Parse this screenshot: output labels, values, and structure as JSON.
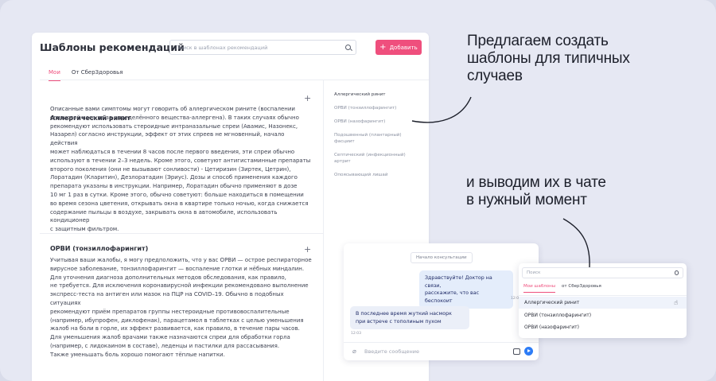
{
  "window": {
    "title": "Шаблоны рекомендаций",
    "search_placeholder": "Поиск в шаблонах рекомендаций",
    "add_label": "Добавить",
    "tabs": [
      "Мои",
      "От СберЗдоровья"
    ]
  },
  "templates": [
    {
      "title": "Аллергический ринит",
      "text": "Описанные вами симптомы могут говорить об аллергическом рините (воспалении\nслизистой носа из-за определённого вещества-аллергена). В таких случаях обычно\nрекомендуют использовать стероидные интраназальные спреи (Авамис, Назонекс,\nНазарел) согласно инструкции, эффект от этих спреев не мгновенный, начало действия\nможет наблюдаться в течении 8 часов после первого введения, эти спреи обычно\nиспользуют в течении 2–3 недель. Кроме этого, советуют антигистаминные препараты\nвторого поколения (они не вызывают сонливости) - Цетиризин (Зиртек, Цетрин),\nЛоратадин (Кларитин), Дезлоратадин (Эриус). Дозы и способ применения каждого\nпрепарата указаны в инструкции. Например, Лоратадин обычно применяют в дозе\n10 мг 1 раз в сутки. Кроме этого, обычно советуют: больше находиться в помещении\nво время сезона цветения, открывать окна в квартире только ночью, когда снижается\nсодержание пыльцы в воздухе, закрывать окна в автомобиле, использовать кондиционер\nс защитным фильтром."
    },
    {
      "title": "ОРВИ (тонзиллофарингит)",
      "text": "Учитывая ваши жалобы, я могу предположить, что у вас ОРВИ — острое респираторное\nвирусное заболевание, тонзиллофарингит — воспаление глотки и нёбных миндалин.\nДля уточнения диагноза дополнительных методов обследования, как правило,\nне требуется. Для исключения коронавирусной инфекции рекомендовано выполнение\nэкспресс-теста на антиген или мазок на ПЦР на COVID–19. Обычно в подобных ситуациях\nрекомендуют приём препаратов группы нестероидные противовоспалительные\n(например, ибупрофен, диклофенак), парацетамол в таблетках с целью уменьшения\nжалоб на боли в горле, их эффект развивается, как правило, в течение пары часов.\nДля уменьшения жалоб врачами также назначаются спреи для обработки горла\n(например, с лидокаином в составе), леденцы и пастилки для рассасывания.\nТакже уменьшать боль хорошо помогают тёплые напитки."
    }
  ],
  "nav": [
    "Аллергический ринит",
    "ОРВИ (тонзиллофарингит)",
    "ОРВИ (назофарингит)",
    "Подошвенный (плантарный)\nфасциит",
    "Септический (инфекционный)\nартрит",
    "Опоясывающий лишай"
  ],
  "headline1": "Предлагаем создать\nшаблоны для типичных\nслучаев",
  "headline2": "и выводим их в чате\nв нужный момент",
  "chat": {
    "start_label": "Начало консультации",
    "doctor_msg": "Здравствуйте! Доктор на связи,\nрасскажите, что вас беспокоит",
    "doctor_time": "12:01",
    "patient_msg": "В последнее время жуткий насморк\nпри встрече с тополиным пухом",
    "patient_time": "12:03",
    "input_placeholder": "Введите сообщение"
  },
  "dropdown": {
    "search_placeholder": "Поиск",
    "tabs": [
      "Мои шаблоны",
      "от СберЗдоровья"
    ],
    "items": [
      "Аллергический ринит",
      "ОРВИ (тонзиллофарингит)",
      "ОРВИ (назофарингит)"
    ]
  },
  "colors": {
    "accent": "#ef4f7d",
    "send": "#2d7cf6",
    "background": "#e6e8f3"
  }
}
